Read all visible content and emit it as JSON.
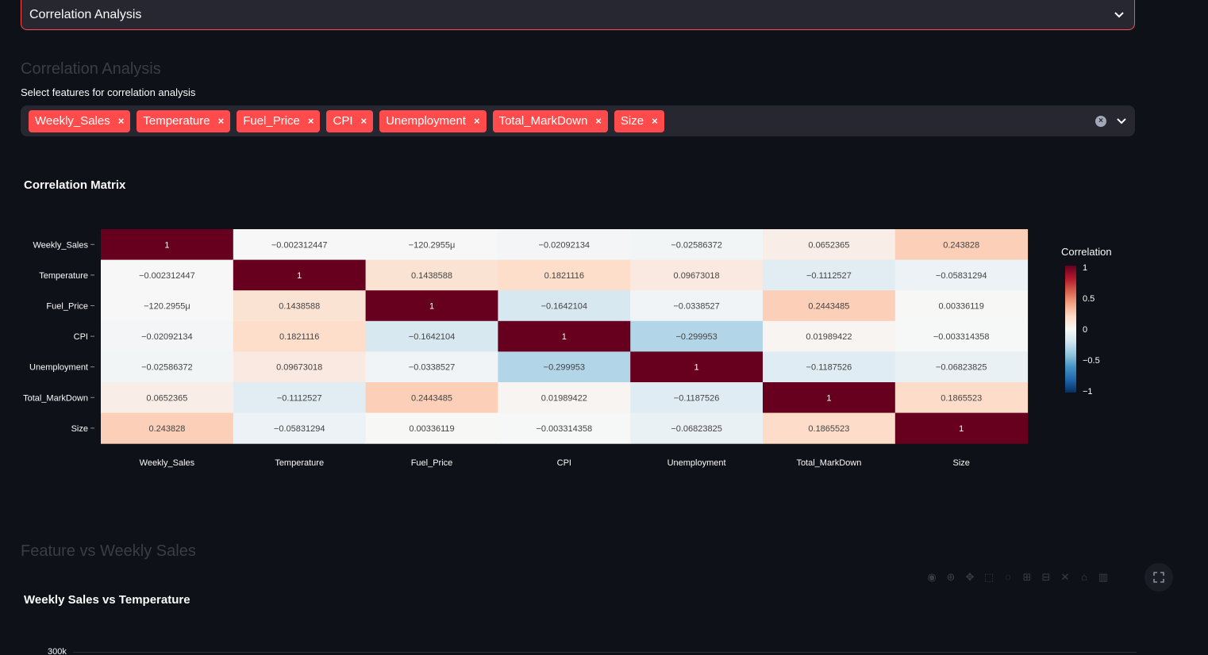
{
  "expander": {
    "title": "Correlation Analysis"
  },
  "section": {
    "heading": "Correlation Analysis"
  },
  "multiselect": {
    "label": "Select features for correlation analysis",
    "selected": [
      "Weekly_Sales",
      "Temperature",
      "Fuel_Price",
      "CPI",
      "Unemployment",
      "Total_MarkDown",
      "Size"
    ]
  },
  "heatmap_title": "Correlation Matrix",
  "colors": {
    "accent": "#ff4b4b",
    "background": "#0e1117",
    "widget_bg": "#262730"
  },
  "chart_data": {
    "type": "heatmap",
    "title": "Correlation Matrix",
    "x_labels": [
      "Weekly_Sales",
      "Temperature",
      "Fuel_Price",
      "CPI",
      "Unemployment",
      "Total_MarkDown",
      "Size"
    ],
    "y_labels": [
      "Weekly_Sales",
      "Temperature",
      "Fuel_Price",
      "CPI",
      "Unemployment",
      "Total_MarkDown",
      "Size"
    ],
    "values": [
      [
        1,
        -0.002312447,
        -0.0001202955,
        -0.02092134,
        -0.02586372,
        0.0652365,
        0.243828
      ],
      [
        -0.002312447,
        1,
        0.1438588,
        0.1821116,
        0.09673018,
        -0.1112527,
        -0.05831294
      ],
      [
        -0.0001202955,
        0.1438588,
        1,
        -0.1642104,
        -0.0338527,
        0.2443485,
        0.00336119
      ],
      [
        -0.02092134,
        0.1821116,
        -0.1642104,
        1,
        -0.299953,
        0.01989422,
        -0.003314358
      ],
      [
        -0.02586372,
        0.09673018,
        -0.0338527,
        -0.299953,
        1,
        -0.1187526,
        -0.06823825
      ],
      [
        0.0652365,
        -0.1112527,
        0.2443485,
        0.01989422,
        -0.1187526,
        1,
        0.1865523
      ],
      [
        0.243828,
        -0.05831294,
        0.00336119,
        -0.003314358,
        -0.06823825,
        0.1865523,
        1
      ]
    ],
    "cell_text": [
      [
        "1",
        "−0.002312447",
        "−120.2955μ",
        "−0.02092134",
        "−0.02586372",
        "0.0652365",
        "0.243828"
      ],
      [
        "−0.002312447",
        "1",
        "0.1438588",
        "0.1821116",
        "0.09673018",
        "−0.1112527",
        "−0.05831294"
      ],
      [
        "−120.2955μ",
        "0.1438588",
        "1",
        "−0.1642104",
        "−0.0338527",
        "0.2443485",
        "0.00336119"
      ],
      [
        "−0.02092134",
        "0.1821116",
        "−0.1642104",
        "1",
        "−0.299953",
        "0.01989422",
        "−0.003314358"
      ],
      [
        "−0.02586372",
        "0.09673018",
        "−0.0338527",
        "−0.299953",
        "1",
        "−0.1187526",
        "−0.06823825"
      ],
      [
        "0.0652365",
        "−0.1112527",
        "0.2443485",
        "0.01989422",
        "−0.1187526",
        "1",
        "0.1865523"
      ],
      [
        "0.243828",
        "−0.05831294",
        "0.00336119",
        "−0.003314358",
        "−0.06823825",
        "0.1865523",
        "1"
      ]
    ],
    "colorbar": {
      "title": "Correlation",
      "ticks": [
        "1",
        "0.5",
        "0",
        "−0.5",
        "−1"
      ],
      "range": [
        -1,
        1
      ],
      "colorscale": "RdBu"
    }
  },
  "feature_section": {
    "heading": "Feature vs Weekly Sales"
  },
  "scatter": {
    "title": "Weekly Sales vs Temperature",
    "y_tick_top": "300k"
  },
  "modebar_icons": [
    "camera-icon",
    "zoom-icon",
    "pan-icon",
    "select-box-icon",
    "lasso-icon",
    "zoom-in-icon",
    "zoom-out-icon",
    "autoscale-icon",
    "reset-axes-icon",
    "plotly-logo-icon"
  ]
}
